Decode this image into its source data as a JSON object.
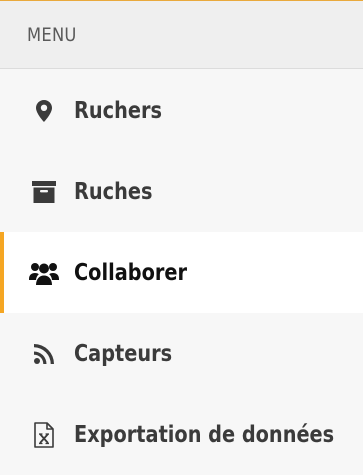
{
  "menu": {
    "header": "MENU",
    "accent_color": "#f5a623",
    "items": [
      {
        "label": "Ruchers",
        "icon": "map-marker-icon",
        "active": false
      },
      {
        "label": "Ruches",
        "icon": "archive-box-icon",
        "active": false
      },
      {
        "label": "Collaborer",
        "icon": "users-group-icon",
        "active": true
      },
      {
        "label": "Capteurs",
        "icon": "rss-feed-icon",
        "active": false
      },
      {
        "label": "Exportation de données",
        "icon": "excel-file-icon",
        "active": false
      }
    ]
  }
}
